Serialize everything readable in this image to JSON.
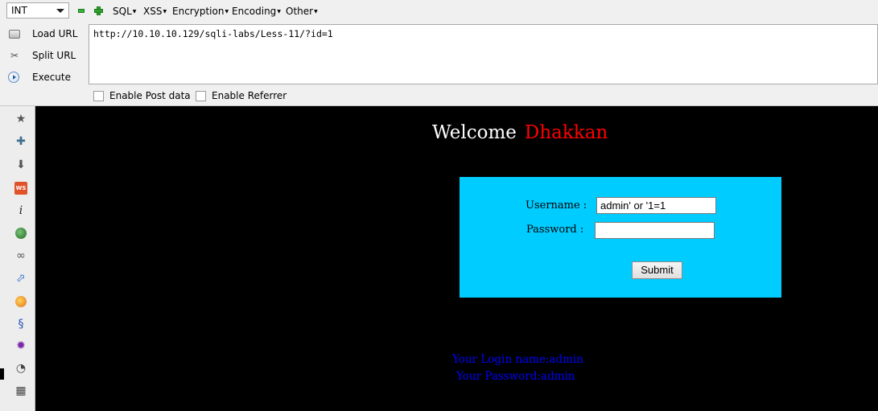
{
  "hackbar": {
    "select_value": "INT",
    "menus": {
      "sql": "SQL",
      "xss": "XSS",
      "encryption": "Encryption",
      "encoding": "Encoding",
      "other": "Other"
    },
    "actions": {
      "load_url": "Load URL",
      "split_url": "Split URL",
      "execute": "Execute"
    },
    "url": "http://10.10.10.129/sqli-labs/Less-11/?id=1",
    "options": {
      "post_data": "Enable Post data",
      "referrer": "Enable Referrer"
    }
  },
  "sidebar": {
    "icons": [
      "star-icon",
      "puzzle-icon",
      "download-icon",
      "ws-icon",
      "info-icon",
      "green-ball-icon",
      "glasses-icon",
      "pointer-icon",
      "orange-ball-icon",
      "swirl-icon",
      "virus-icon",
      "cookie-icon",
      "layout-icon"
    ]
  },
  "page": {
    "welcome": "Welcome",
    "name": "Dhakkan",
    "form": {
      "username_label": "Username :",
      "password_label": "Password :",
      "username_value": "admin' or '1=1",
      "password_value": "",
      "submit": "Submit"
    },
    "result": {
      "login_line": "Your Login name:admin",
      "password_line": "Your Password:admin"
    }
  },
  "colors": {
    "page_background": "#000000",
    "welcome_name": "#ff0000",
    "form_background": "#00ccff",
    "result_text": "#0000ff"
  }
}
